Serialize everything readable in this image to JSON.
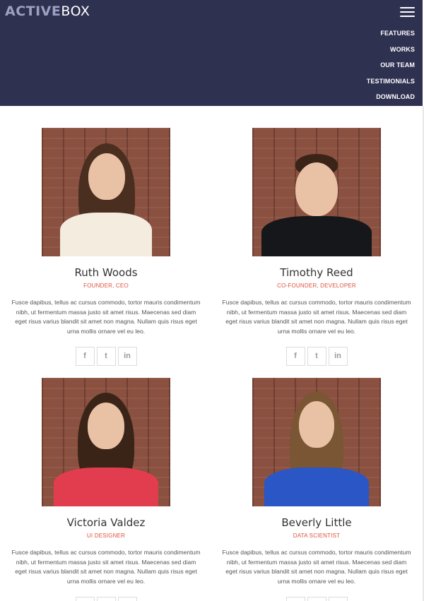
{
  "brand": {
    "logo_bold": "ACTIVE",
    "logo_thin": "BOX"
  },
  "nav": {
    "items": [
      {
        "label": "FEATURES"
      },
      {
        "label": "WORKS"
      },
      {
        "label": "OUR TEAM"
      },
      {
        "label": "TESTIMONIALS"
      },
      {
        "label": "DOWNLOAD"
      }
    ]
  },
  "team": [
    {
      "name": "Ruth Woods",
      "role": "FOUNDER, CEO",
      "bio": "Fusce dapibus, tellus ac cursus commodo, tortor mauris condimentum nibh, ut fermentum massa justo sit amet risus. Maecenas sed diam eget risus varius blandit sit amet non magna. Nullam quis risus eget urna mollis ornare vel eu leo.",
      "social": [
        "f",
        "t",
        "in"
      ]
    },
    {
      "name": "Timothy Reed",
      "role": "CO-FOUNDER, DEVELOPER",
      "bio": "Fusce dapibus, tellus ac cursus commodo, tortor mauris condimentum nibh, ut fermentum massa justo sit amet risus. Maecenas sed diam eget risus varius blandit sit amet non magna. Nullam quis risus eget urna mollis ornare vel eu leo.",
      "social": [
        "f",
        "t",
        "in"
      ]
    },
    {
      "name": "Victoria Valdez",
      "role": "UI DESIGNER",
      "bio": "Fusce dapibus, tellus ac cursus commodo, tortor mauris condimentum nibh, ut fermentum massa justo sit amet risus. Maecenas sed diam eget risus varius blandit sit amet non magna. Nullam quis risus eget urna mollis ornare vel eu leo.",
      "social": [
        "f",
        "t",
        "in"
      ]
    },
    {
      "name": "Beverly Little",
      "role": "DATA SCIENTIST",
      "bio": "Fusce dapibus, tellus ac cursus commodo, tortor mauris condimentum nibh, ut fermentum massa justo sit amet risus. Maecenas sed diam eget risus varius blandit sit amet non magna. Nullam quis risus eget urna mollis ornare vel eu leo.",
      "social": [
        "f",
        "t",
        "in"
      ]
    }
  ],
  "colors": {
    "header_bg": "#2f3150",
    "accent": "#e0513c"
  }
}
